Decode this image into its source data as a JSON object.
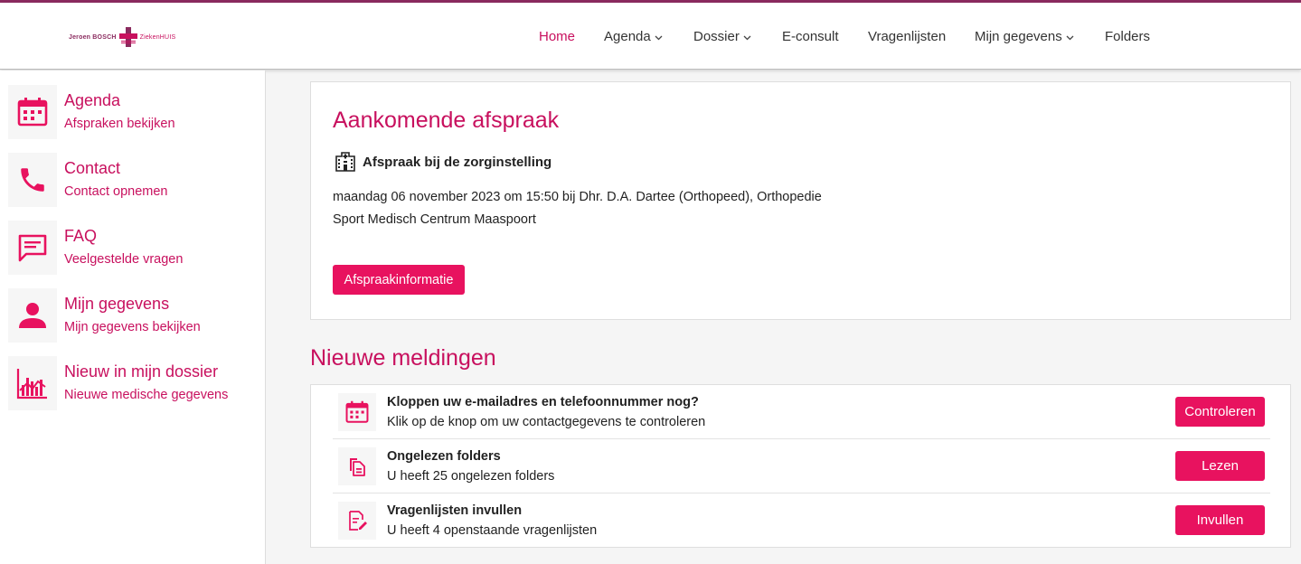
{
  "colors": {
    "accent": "#c8105e",
    "button": "#e8125f",
    "brand_purple": "#8a2a5e"
  },
  "logo": {
    "left_text": "Jeroen BOSCH",
    "right_text": "ZiekenHUIS"
  },
  "nav": [
    {
      "label": "Home",
      "active": true,
      "dropdown": false
    },
    {
      "label": "Agenda",
      "active": false,
      "dropdown": true
    },
    {
      "label": "Dossier",
      "active": false,
      "dropdown": true
    },
    {
      "label": "E-consult",
      "active": false,
      "dropdown": false
    },
    {
      "label": "Vragenlijsten",
      "active": false,
      "dropdown": false
    },
    {
      "label": "Mijn gegevens",
      "active": false,
      "dropdown": true
    },
    {
      "label": "Folders",
      "active": false,
      "dropdown": false
    }
  ],
  "sidebar": [
    {
      "title": "Agenda",
      "subtitle": "Afspraken bekijken",
      "icon": "calendar-icon"
    },
    {
      "title": "Contact",
      "subtitle": "Contact opnemen",
      "icon": "phone-icon"
    },
    {
      "title": "FAQ",
      "subtitle": "Veelgestelde vragen",
      "icon": "chat-icon"
    },
    {
      "title": "Mijn gegevens",
      "subtitle": "Mijn gegevens bekijken",
      "icon": "person-icon"
    },
    {
      "title": "Nieuw in mijn dossier",
      "subtitle": "Nieuwe medische gegevens",
      "icon": "chart-icon"
    }
  ],
  "appointment": {
    "title": "Aankomende afspraak",
    "subtitle": "Afspraak bij de zorginstelling",
    "line1": "maandag 06 november 2023 om 15:50 bij Dhr. D.A. Dartee (Orthopeed), Orthopedie",
    "line2": "Sport Medisch Centrum Maaspoort",
    "button": "Afspraakinformatie"
  },
  "notifications": {
    "title": "Nieuwe meldingen",
    "items": [
      {
        "heading": "Kloppen uw e-mailadres en telefoonnummer nog?",
        "description": "Klik op de knop om uw contactgegevens te controleren",
        "button": "Controleren",
        "icon": "calendar-icon"
      },
      {
        "heading": "Ongelezen folders",
        "description": "U heeft 25 ongelezen folders",
        "button": "Lezen",
        "icon": "documents-icon"
      },
      {
        "heading": "Vragenlijsten invullen",
        "description": "U heeft 4 openstaande vragenlijsten",
        "button": "Invullen",
        "icon": "form-edit-icon"
      }
    ]
  }
}
